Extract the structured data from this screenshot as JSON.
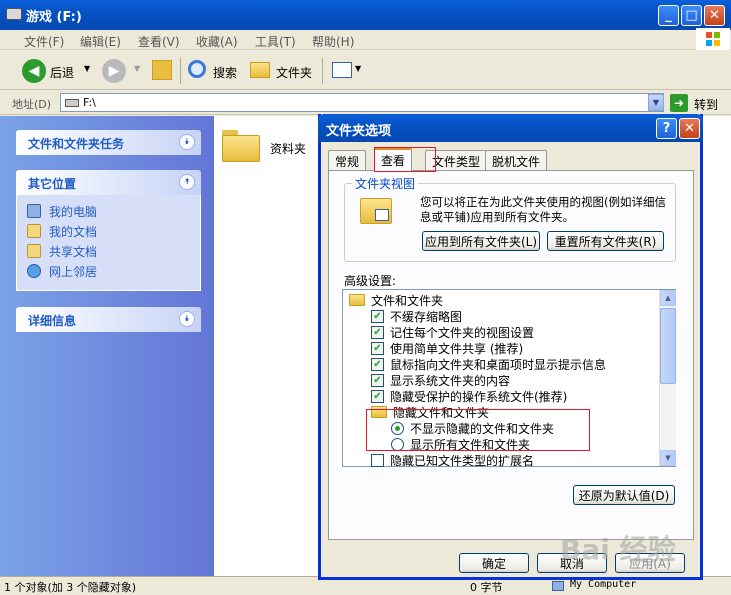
{
  "explorer": {
    "title": "游戏  (F:)",
    "menu": [
      "文件(F)",
      "编辑(E)",
      "查看(V)",
      "收藏(A)",
      "工具(T)",
      "帮助(H)"
    ],
    "toolbar": {
      "back": "后退",
      "search": "搜索",
      "folders": "文件夹"
    },
    "address_label": "地址(D)",
    "address_value": "F:\\",
    "go_label": "转到",
    "tasks": {
      "panel1": "文件和文件夹任务",
      "panel2": "其它位置",
      "other_places": [
        "我的电脑",
        "我的文档",
        "共享文档",
        "网上邻居"
      ],
      "panel3": "详细信息"
    },
    "content_items": [
      "资料夹"
    ],
    "status": {
      "left": "1 个对象(加 3 个隐藏对象)",
      "size": "0 字节",
      "location": "My Computer"
    }
  },
  "dialog": {
    "title": "文件夹选项",
    "tabs": [
      "常规",
      "查看",
      "文件类型",
      "脱机文件"
    ],
    "active_tab": "查看",
    "folder_view": {
      "group_title": "文件夹视图",
      "description": "您可以将正在为此文件夹使用的视图(例如详细信息或平铺)应用到所有文件夹。",
      "apply_all": "应用到所有文件夹(L)",
      "reset_all": "重置所有文件夹(R)"
    },
    "advanced_label": "高级设置:",
    "advanced_root": "文件和文件夹",
    "checks": [
      {
        "label": "不缓存缩略图",
        "checked": true
      },
      {
        "label": "记住每个文件夹的视图设置",
        "checked": true
      },
      {
        "label": "使用简单文件共享 (推荐)",
        "checked": true
      },
      {
        "label": "鼠标指向文件夹和桌面项时显示提示信息",
        "checked": true
      },
      {
        "label": "显示系统文件夹的内容",
        "checked": true
      },
      {
        "label": "隐藏受保护的操作系统文件(推荐)",
        "checked": true
      }
    ],
    "hidden_group": "隐藏文件和文件夹",
    "radios": [
      {
        "label": "不显示隐藏的文件和文件夹",
        "selected": true
      },
      {
        "label": "显示所有文件和文件夹",
        "selected": false
      }
    ],
    "last_check": {
      "label": "隐藏已知文件类型的扩展名",
      "checked": false
    },
    "restore_defaults": "还原为默认值(D)",
    "ok": "确定",
    "cancel": "取消",
    "apply": "应用(A)"
  },
  "watermark": "Bai 经验",
  "colors": {
    "xp_blue": "#0652c6",
    "task_blue": "#215dc6",
    "highlight_red": "#e0182e",
    "check_green": "#21a121"
  }
}
